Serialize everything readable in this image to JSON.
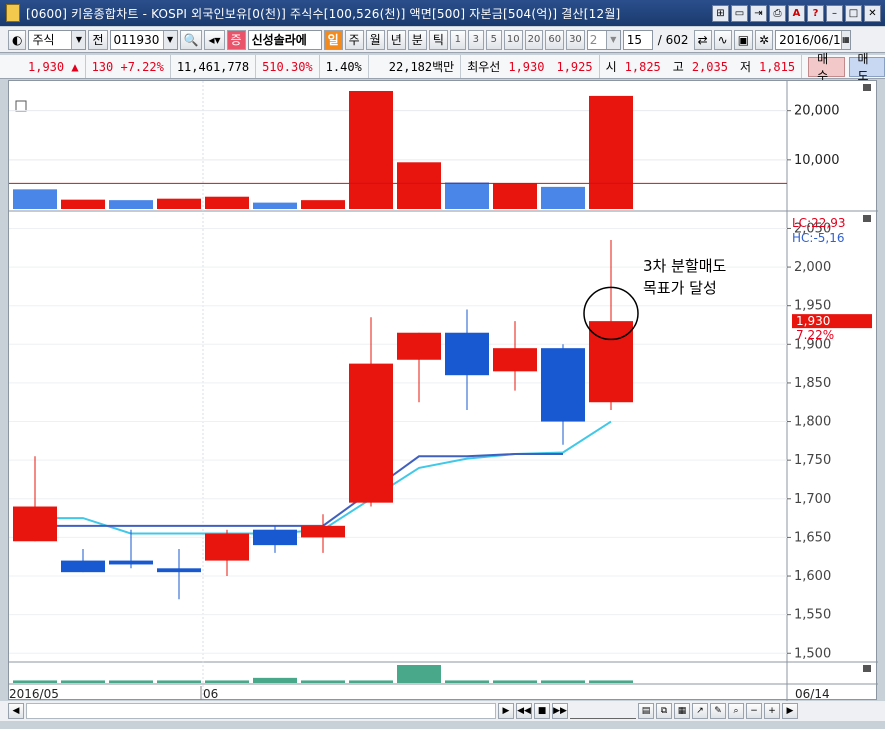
{
  "window": {
    "title": "[0600] 키움종합차트 - KOSPI 외국인보유[0(천)] 주식수[100,526(천)] 액면[500] 자본금[504(억)] 결산[12월]"
  },
  "toolbar": {
    "market_type": "주식",
    "prev_label": "전",
    "code": "011930",
    "stock_name": "신성솔라에",
    "badge": "증",
    "periods": [
      "일",
      "주",
      "월",
      "년",
      "분",
      "틱"
    ],
    "intervals": [
      "1",
      "3",
      "5",
      "10",
      "20",
      "60",
      "30"
    ],
    "interval_input": "2",
    "count": "15",
    "total": "/ 602",
    "date": "2016/06/1"
  },
  "quote": {
    "price": "1,930 ▲",
    "change": "130 +7.22%",
    "volume": "11,461,778",
    "vol_ratio": "510.30%",
    "turnover": "1.40%",
    "amount": "22,182백만",
    "best_label": "최우선",
    "ask": "1,930",
    "bid": "1,925",
    "open_label": "시",
    "open": "1,825",
    "high_label": "고",
    "high": "2,035",
    "low_label": "저",
    "low": "1,815",
    "buy_btn": "매수",
    "sell_btn": "매도"
  },
  "chart_data": {
    "type": "candlestick",
    "y_axis_ticks": [
      "2,050",
      "2,000",
      "1,950",
      "1,900",
      "1,850",
      "1,800",
      "1,750",
      "1,700",
      "1,650",
      "1,600",
      "1,550",
      "1,500"
    ],
    "ylim": [
      1490,
      2070
    ],
    "lc_label": "LC:22,93",
    "hc_label": "HC:-5,16",
    "last_price_label": "1,930",
    "last_change_label": "7.22%",
    "annotation": [
      "3차 분할매도",
      "목표가 달성"
    ],
    "candles": [
      {
        "open": 1645,
        "close": 1690,
        "high": 1755,
        "low": 1645
      },
      {
        "open": 1620,
        "close": 1605,
        "high": 1635,
        "low": 1605
      },
      {
        "open": 1620,
        "close": 1615,
        "high": 1660,
        "low": 1610
      },
      {
        "open": 1610,
        "close": 1605,
        "high": 1635,
        "low": 1570
      },
      {
        "open": 1620,
        "close": 1655,
        "high": 1660,
        "low": 1600
      },
      {
        "open": 1660,
        "close": 1640,
        "high": 1665,
        "low": 1630
      },
      {
        "open": 1650,
        "close": 1665,
        "high": 1680,
        "low": 1630
      },
      {
        "open": 1695,
        "close": 1875,
        "high": 1935,
        "low": 1690
      },
      {
        "open": 1880,
        "close": 1915,
        "high": 1915,
        "low": 1825
      },
      {
        "open": 1915,
        "close": 1860,
        "high": 1945,
        "low": 1815
      },
      {
        "open": 1865,
        "close": 1895,
        "high": 1930,
        "low": 1840
      },
      {
        "open": 1895,
        "close": 1800,
        "high": 1900,
        "low": 1770
      },
      {
        "open": 1825,
        "close": 1930,
        "high": 2035,
        "low": 1815
      }
    ],
    "ma_dark": [
      1665,
      1665,
      1665,
      1665,
      1665,
      1665,
      1665,
      1710,
      1755,
      1755,
      1758,
      1758,
      null
    ],
    "ma_light": [
      1675,
      1675,
      1655,
      1655,
      1655,
      1655,
      1660,
      1700,
      1740,
      1752,
      1758,
      1760,
      1800
    ],
    "volume_panel": {
      "y_axis_ticks": [
        "20,000",
        "10,000"
      ],
      "ylim": [
        0,
        24000
      ],
      "values": [
        4000,
        1900,
        1800,
        2100,
        2500,
        1300,
        1800,
        24000,
        9500,
        5400,
        5200,
        4500,
        23000
      ],
      "colors": [
        "blue",
        "red",
        "blue",
        "red",
        "red",
        "blue",
        "red",
        "red",
        "red",
        "blue",
        "red",
        "blue",
        "red"
      ],
      "ref_line": 5200
    },
    "bottom_panel": {
      "values": [
        1,
        1,
        1,
        1,
        1,
        2,
        1,
        1,
        7,
        1,
        1,
        1,
        1
      ]
    },
    "x_labels": [
      {
        "label": "2016/05",
        "index": 0
      },
      {
        "label": "06",
        "index": 4
      },
      {
        "label": "06/14",
        "index": 13
      }
    ]
  },
  "colors": {
    "up": "#e8140e",
    "down": "#1858d0",
    "ma_dark": "#4060c0",
    "ma_light": "#40c8e8",
    "volume_green": "#4aa88a"
  }
}
